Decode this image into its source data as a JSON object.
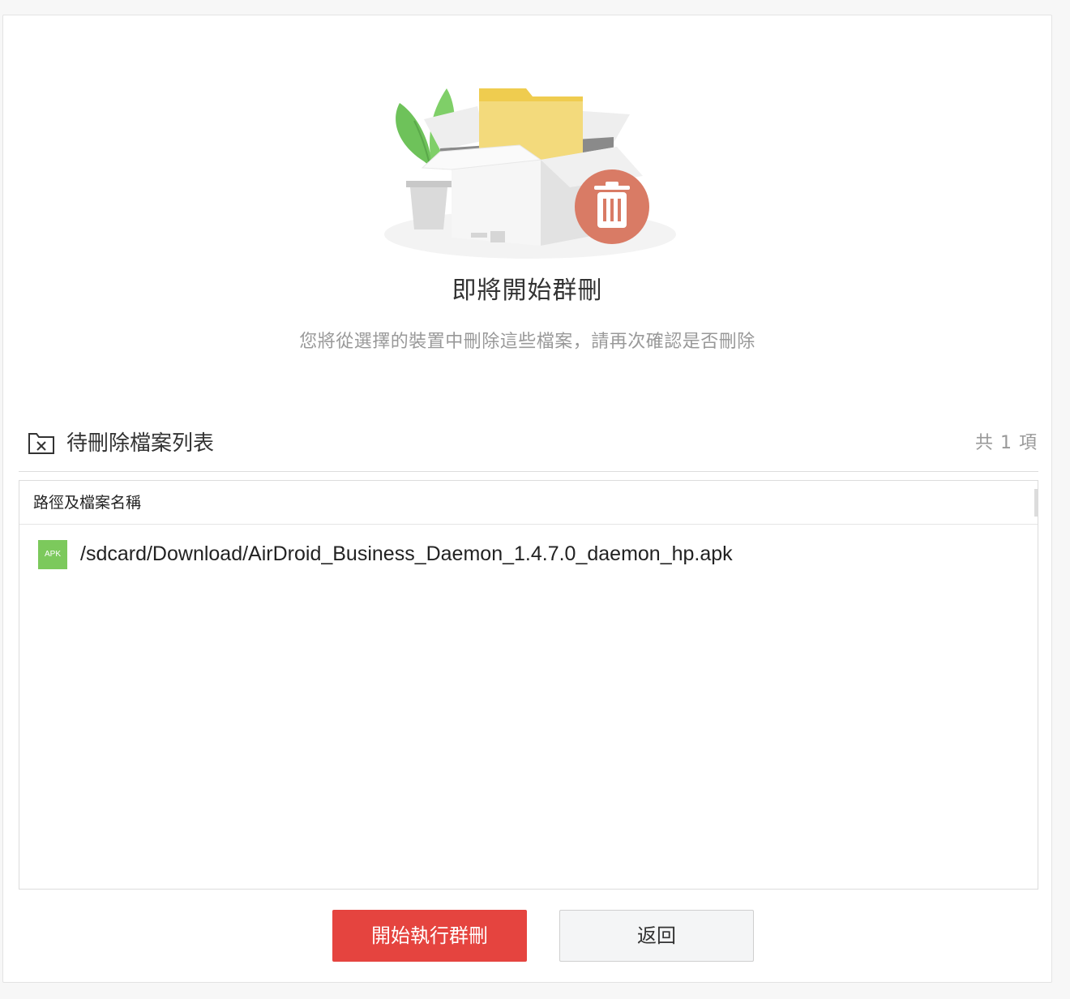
{
  "dialog": {
    "title": "即將開始群刪",
    "subtitle": "您將從選擇的裝置中刪除這些檔案，請再次確認是否刪除",
    "illustration": "box-with-folder-plant-and-trash-icon"
  },
  "file_list": {
    "icon": "folder-x-icon",
    "label": "待刪除檔案列表",
    "count_text": "共 1 項",
    "column_header": "路徑及檔案名稱",
    "rows": [
      {
        "icon_text": "APK",
        "path": "/sdcard/Download/AirDroid_Business_Daemon_1.4.7.0_daemon_hp.apk"
      }
    ]
  },
  "actions": {
    "start_label": "開始執行群刪",
    "back_label": "返回"
  },
  "colors": {
    "primary": "#e5443f",
    "apk_badge": "#7cc95c",
    "trash_badge": "#d97b65",
    "folder": "#f1d978"
  }
}
